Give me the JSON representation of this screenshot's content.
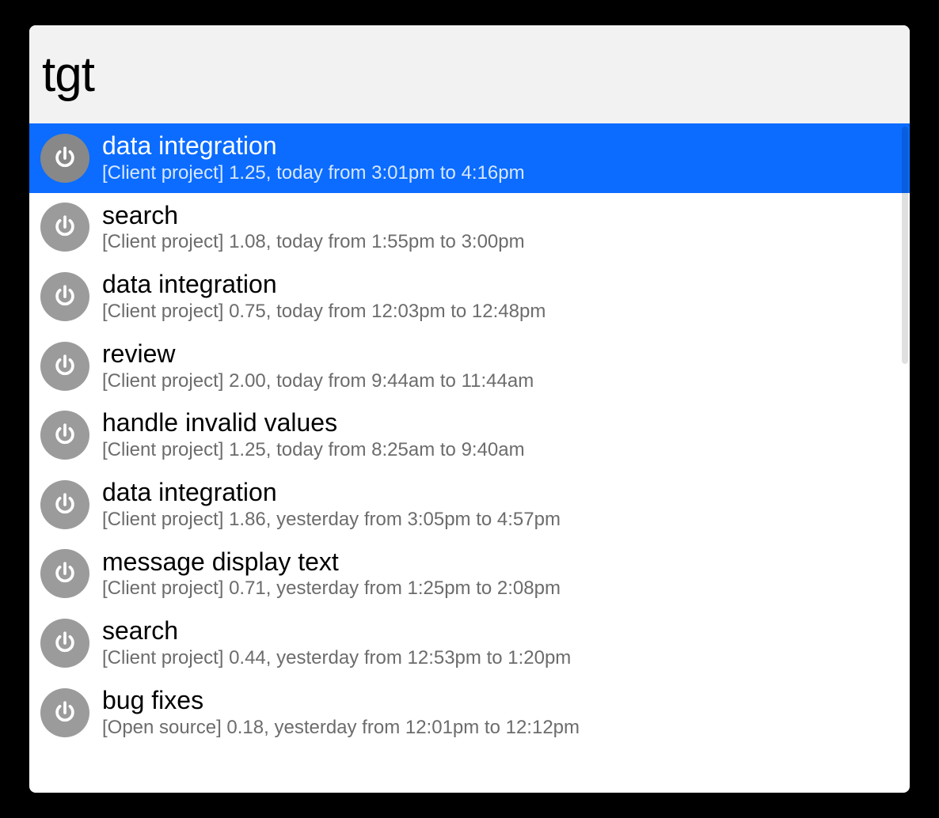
{
  "search": {
    "value": "tgt"
  },
  "colors": {
    "selected_bg": "#0b6cff",
    "icon_bg": "#9b9b9b",
    "subtitle": "#6c6c6c"
  },
  "results": [
    {
      "title": "data integration",
      "subtitle": "[Client project] 1.25, today from 3:01pm to 4:16pm",
      "selected": true
    },
    {
      "title": "search",
      "subtitle": "[Client project] 1.08, today from 1:55pm to 3:00pm",
      "selected": false
    },
    {
      "title": "data integration",
      "subtitle": "[Client project] 0.75, today from 12:03pm to 12:48pm",
      "selected": false
    },
    {
      "title": "review",
      "subtitle": "[Client project] 2.00, today from 9:44am to 11:44am",
      "selected": false
    },
    {
      "title": "handle invalid values",
      "subtitle": "[Client project] 1.25, today from 8:25am to 9:40am",
      "selected": false
    },
    {
      "title": "data integration",
      "subtitle": "[Client project] 1.86, yesterday from 3:05pm to 4:57pm",
      "selected": false
    },
    {
      "title": "message display text",
      "subtitle": "[Client project] 0.71, yesterday from 1:25pm to 2:08pm",
      "selected": false
    },
    {
      "title": "search",
      "subtitle": "[Client project] 0.44, yesterday from 12:53pm to 1:20pm",
      "selected": false
    },
    {
      "title": "bug fixes",
      "subtitle": "[Open source] 0.18, yesterday from 12:01pm to 12:12pm",
      "selected": false
    }
  ]
}
